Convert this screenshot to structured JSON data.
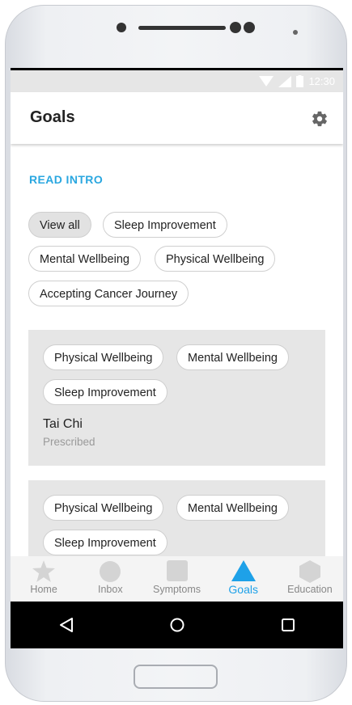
{
  "status": {
    "time": "12:30"
  },
  "appbar": {
    "title": "Goals"
  },
  "intro": {
    "label": "READ INTRO"
  },
  "filters": {
    "chips": [
      "View all",
      "Sleep Improvement",
      "Mental Wellbeing",
      "Physical Wellbeing",
      "Accepting Cancer Journey"
    ],
    "selected": "View all"
  },
  "cards": [
    {
      "tags": [
        "Physical Wellbeing",
        "Mental Wellbeing",
        "Sleep Improvement"
      ],
      "title": "Tai Chi",
      "subtitle": "Prescribed"
    },
    {
      "tags": [
        "Physical Wellbeing",
        "Mental Wellbeing",
        "Sleep Improvement"
      ]
    }
  ],
  "bottom_nav": {
    "items": [
      {
        "label": "Home",
        "icon": "star-icon"
      },
      {
        "label": "Inbox",
        "icon": "circle-icon"
      },
      {
        "label": "Symptoms",
        "icon": "square-icon"
      },
      {
        "label": "Goals",
        "icon": "triangle-icon"
      },
      {
        "label": "Education",
        "icon": "hexagon-icon"
      }
    ],
    "active": "Goals"
  },
  "system_nav": {
    "icons": [
      "back-icon",
      "home-icon",
      "recents-icon"
    ]
  },
  "colors": {
    "accent": "#1ea1e8",
    "card_bg": "#e6e6e6",
    "chip_selected_bg": "#e2e2e2"
  }
}
